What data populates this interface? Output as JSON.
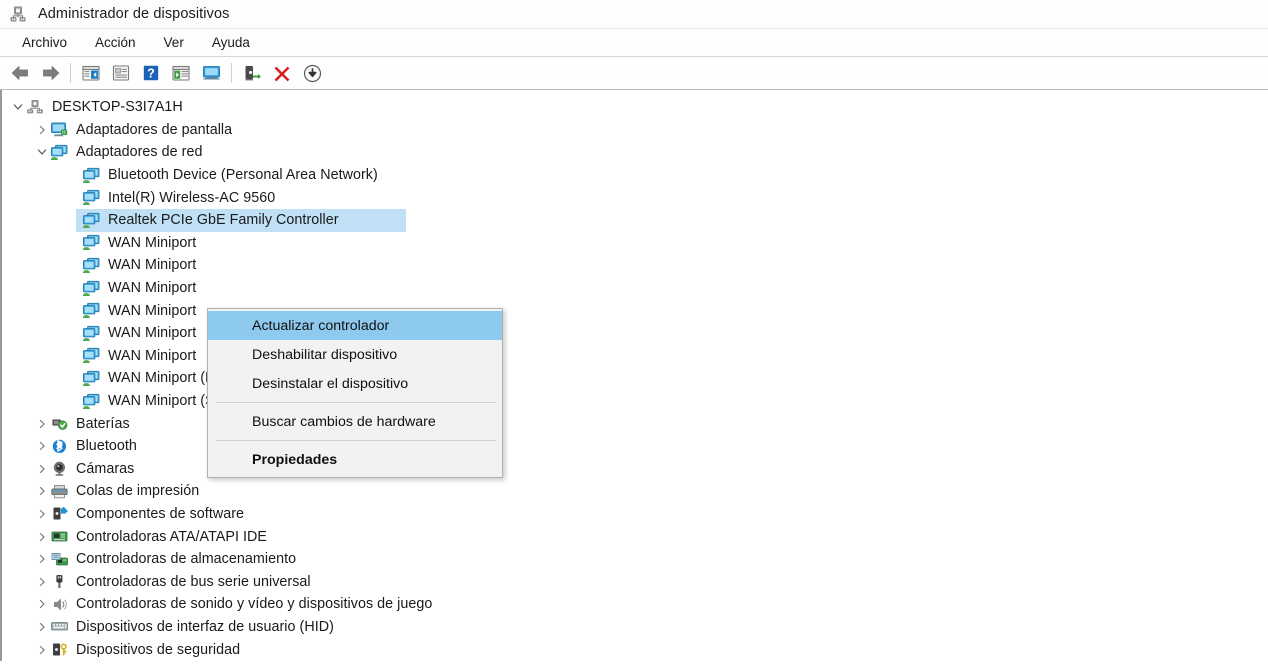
{
  "window": {
    "title": "Administrador de dispositivos",
    "icon": "device-manager-icon"
  },
  "menubar": {
    "items": [
      {
        "label": "Archivo",
        "name": "menu-archivo"
      },
      {
        "label": "Acción",
        "name": "menu-accion"
      },
      {
        "label": "Ver",
        "name": "menu-ver"
      },
      {
        "label": "Ayuda",
        "name": "menu-ayuda"
      }
    ]
  },
  "toolbar": {
    "buttons": [
      {
        "name": "back-arrow-icon",
        "title": "Atrás"
      },
      {
        "name": "forward-arrow-icon",
        "title": "Adelante"
      },
      {
        "name": "separator-1"
      },
      {
        "name": "show-hide-console-tree-icon",
        "title": "Mostrar/ocultar árbol de consola"
      },
      {
        "name": "properties-icon",
        "title": "Propiedades"
      },
      {
        "name": "help-icon",
        "title": "Ayuda"
      },
      {
        "name": "scan-hardware-changes-icon",
        "title": "Buscar cambios de hardware"
      },
      {
        "name": "monitor-icon",
        "title": "Ver"
      },
      {
        "name": "separator-2"
      },
      {
        "name": "update-driver-icon",
        "title": "Actualizar controlador"
      },
      {
        "name": "uninstall-device-icon",
        "title": "Desinstalar el dispositivo"
      },
      {
        "name": "disable-device-icon",
        "title": "Deshabilitar dispositivo"
      }
    ]
  },
  "tree": {
    "root": {
      "label": "DESKTOP-S3I7A1H",
      "icon": "computer-icon",
      "expanded": true
    },
    "nodes": [
      {
        "label": "Adaptadores de pantalla",
        "icon": "display-adapter-icon",
        "level": 1,
        "expanded": false,
        "hasChildren": true
      },
      {
        "label": "Adaptadores de red",
        "icon": "network-adapter-icon",
        "level": 1,
        "expanded": true,
        "hasChildren": true
      },
      {
        "label": "Bluetooth Device (Personal Area Network)",
        "icon": "network-adapter-icon",
        "level": 2,
        "hasChildren": false
      },
      {
        "label": "Intel(R) Wireless-AC 9560",
        "icon": "network-adapter-icon",
        "level": 2,
        "hasChildren": false
      },
      {
        "label": "Realtek PCIe GbE Family Controller",
        "icon": "network-adapter-icon",
        "level": 2,
        "hasChildren": false,
        "selected": true
      },
      {
        "label": "WAN Miniport",
        "icon": "network-adapter-icon",
        "level": 2,
        "hasChildren": false
      },
      {
        "label": "WAN Miniport",
        "icon": "network-adapter-icon",
        "level": 2,
        "hasChildren": false
      },
      {
        "label": "WAN Miniport",
        "icon": "network-adapter-icon",
        "level": 2,
        "hasChildren": false
      },
      {
        "label": "WAN Miniport",
        "icon": "network-adapter-icon",
        "level": 2,
        "hasChildren": false
      },
      {
        "label": "WAN Miniport",
        "icon": "network-adapter-icon",
        "level": 2,
        "hasChildren": false
      },
      {
        "label": "WAN Miniport",
        "icon": "network-adapter-icon",
        "level": 2,
        "hasChildren": false
      },
      {
        "label": "WAN Miniport (PPTP)",
        "icon": "network-adapter-icon",
        "level": 2,
        "hasChildren": false
      },
      {
        "label": "WAN Miniport (SSTP)",
        "icon": "network-adapter-icon",
        "level": 2,
        "hasChildren": false
      },
      {
        "label": "Baterías",
        "icon": "battery-icon",
        "level": 1,
        "expanded": false,
        "hasChildren": true
      },
      {
        "label": "Bluetooth",
        "icon": "bluetooth-icon",
        "level": 1,
        "expanded": false,
        "hasChildren": true
      },
      {
        "label": "Cámaras",
        "icon": "camera-icon",
        "level": 1,
        "expanded": false,
        "hasChildren": true
      },
      {
        "label": "Colas de impresión",
        "icon": "printer-icon",
        "level": 1,
        "expanded": false,
        "hasChildren": true
      },
      {
        "label": "Componentes de software",
        "icon": "software-component-icon",
        "level": 1,
        "expanded": false,
        "hasChildren": true
      },
      {
        "label": "Controladoras ATA/ATAPI IDE",
        "icon": "ide-controller-icon",
        "level": 1,
        "expanded": false,
        "hasChildren": true
      },
      {
        "label": "Controladoras de almacenamiento",
        "icon": "storage-controller-icon",
        "level": 1,
        "expanded": false,
        "hasChildren": true
      },
      {
        "label": "Controladoras de bus serie universal",
        "icon": "usb-icon",
        "level": 1,
        "expanded": false,
        "hasChildren": true
      },
      {
        "label": "Controladoras de sonido y vídeo y dispositivos de juego",
        "icon": "speaker-icon",
        "level": 1,
        "expanded": false,
        "hasChildren": true
      },
      {
        "label": "Dispositivos de interfaz de usuario (HID)",
        "icon": "hid-icon",
        "level": 1,
        "expanded": false,
        "hasChildren": true
      },
      {
        "label": "Dispositivos de seguridad",
        "icon": "security-device-icon",
        "level": 1,
        "expanded": false,
        "hasChildren": true
      }
    ]
  },
  "context_menu": {
    "items": [
      {
        "label": "Actualizar controlador",
        "name": "ctx-update-driver",
        "highlighted": true,
        "bold": false
      },
      {
        "label": "Deshabilitar dispositivo",
        "name": "ctx-disable-device",
        "highlighted": false,
        "bold": false
      },
      {
        "label": "Desinstalar el dispositivo",
        "name": "ctx-uninstall-device",
        "highlighted": false,
        "bold": false
      },
      {
        "separator": true
      },
      {
        "label": "Buscar cambios de hardware",
        "name": "ctx-scan-hardware",
        "highlighted": false,
        "bold": false
      },
      {
        "separator": true
      },
      {
        "label": "Propiedades",
        "name": "ctx-properties",
        "highlighted": false,
        "bold": true
      }
    ]
  },
  "colors": {
    "menu_highlight": "#8ec9ee",
    "tree_selection": "#bfe0f5",
    "menu_background": "#f2f2f2",
    "accent_blue": "#1a6fb5",
    "uninstall_red": "#d62020"
  }
}
